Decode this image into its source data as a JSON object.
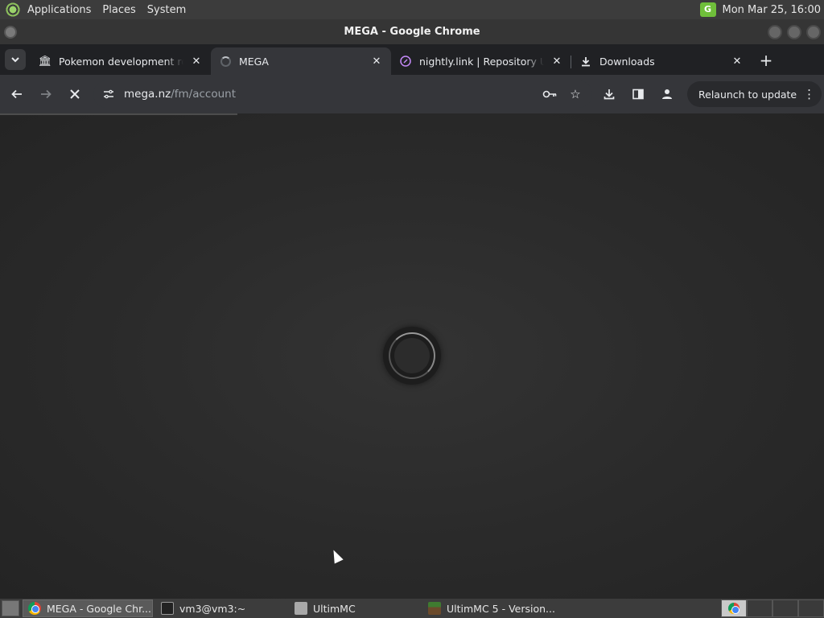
{
  "top_panel": {
    "menus": [
      "Applications",
      "Places",
      "System"
    ],
    "clock": "Mon Mar 25, 16:00",
    "tray_icon": "G"
  },
  "window": {
    "title": "MEGA - Google Chrome"
  },
  "tabs": [
    {
      "title": "Pokemon development rom",
      "icon": "museum-icon",
      "active": false
    },
    {
      "title": "MEGA",
      "icon": "loading-spinner-icon",
      "active": true
    },
    {
      "title": "nightly.link | Repository Ultim",
      "icon": "link-icon",
      "active": false
    },
    {
      "title": "Downloads",
      "icon": "download-icon",
      "active": false
    }
  ],
  "toolbar": {
    "url_host": "mega.nz",
    "url_path": "/fm/account",
    "relaunch_label": "Relaunch to update"
  },
  "taskbar": {
    "tasks": [
      {
        "label": "MEGA - Google Chr...",
        "icon": "chrome-icon",
        "active": true
      },
      {
        "label": "vm3@vm3:~",
        "icon": "terminal-icon",
        "active": false
      },
      {
        "label": "UltimMC",
        "icon": "folder-icon",
        "active": false
      },
      {
        "label": "UltimMC 5 - Version...",
        "icon": "minecraft-icon",
        "active": false
      }
    ]
  },
  "colors": {
    "panel": "#3c3c3c",
    "tabstrip": "#202124",
    "toolbar": "#35363a",
    "content_bg": "#2b2b2b"
  }
}
